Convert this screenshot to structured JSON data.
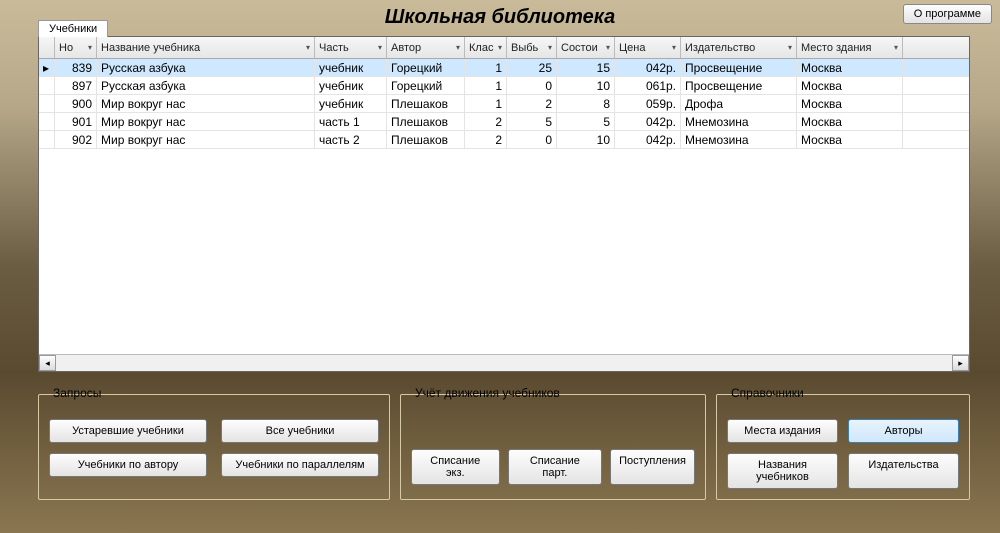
{
  "header": {
    "title": "Школьная библиотека",
    "about": "О программе",
    "tab": "Учебники"
  },
  "table": {
    "columns": [
      "",
      "Но",
      "Название учебника",
      "Часть",
      "Автор",
      "Клас",
      "Выбь",
      "Состои",
      "Цена",
      "Издательство",
      "Место здания"
    ],
    "rows": [
      {
        "selected": true,
        "no": "839",
        "title": "Русская азбука",
        "part": "учебник",
        "author": "Горецкий",
        "grade": "1",
        "vyb": "25",
        "sost": "15",
        "price": "042р.",
        "publisher": "Просвещение",
        "place": "Москва"
      },
      {
        "selected": false,
        "no": "897",
        "title": "Русская азбука",
        "part": "учебник",
        "author": "Горецкий",
        "grade": "1",
        "vyb": "0",
        "sost": "10",
        "price": "061р.",
        "publisher": "Просвещение",
        "place": "Москва"
      },
      {
        "selected": false,
        "no": "900",
        "title": "Мир вокруг нас",
        "part": "учебник",
        "author": "Плешаков",
        "grade": "1",
        "vyb": "2",
        "sost": "8",
        "price": "059р.",
        "publisher": "Дрофа",
        "place": "Москва"
      },
      {
        "selected": false,
        "no": "901",
        "title": "Мир вокруг нас",
        "part": "часть 1",
        "author": "Плешаков",
        "grade": "2",
        "vyb": "5",
        "sost": "5",
        "price": "042р.",
        "publisher": "Мнемозина",
        "place": "Москва"
      },
      {
        "selected": false,
        "no": "902",
        "title": "Мир вокруг нас",
        "part": "часть 2",
        "author": "Плешаков",
        "grade": "2",
        "vyb": "0",
        "sost": "10",
        "price": "042р.",
        "publisher": "Мнемозина",
        "place": "Москва"
      }
    ]
  },
  "groups": {
    "queries": {
      "title": "Запросы",
      "b1": "Устаревшие учебники",
      "b2": "Все учебники",
      "b3": "Учебники по автору",
      "b4": "Учебники по параллелям"
    },
    "movement": {
      "title": "Учёт движения учебников",
      "b1": "Списание экз.",
      "b2": "Списание парт.",
      "b3": "Поступления"
    },
    "refs": {
      "title": "Справочники",
      "b1": "Места издания",
      "b2": "Авторы",
      "b3": "Названия учебников",
      "b4": "Издательства"
    }
  }
}
